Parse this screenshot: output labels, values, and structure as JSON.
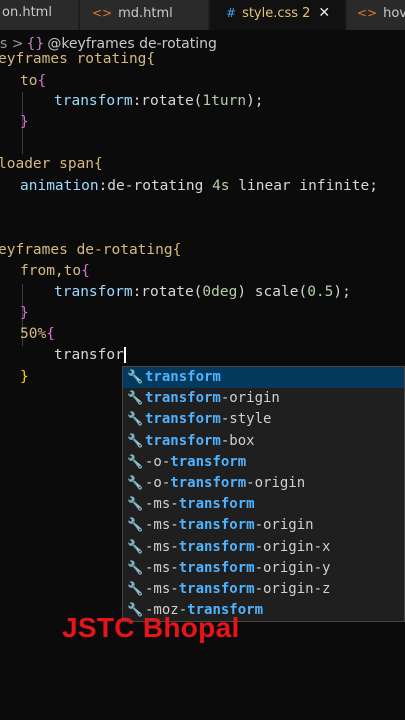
{
  "tabs": [
    {
      "label": "on.html",
      "icon": "",
      "active": false
    },
    {
      "label": "md.html",
      "icon": "<>",
      "active": false
    },
    {
      "label": "style.css",
      "icon": "#",
      "count": "2",
      "active": true
    },
    {
      "label": "hov",
      "icon": "<>",
      "active": false
    }
  ],
  "breadcrumb": {
    "prefix": "s >",
    "icon": "{}",
    "label": "@keyframes de-rotating"
  },
  "code": {
    "l0": "eyframes rotating{",
    "l1_a": "to",
    "l1_b": "{",
    "l2_a": "transform",
    "l2_b": ":rotate(",
    "l2_c": "1turn",
    "l2_d": ");",
    "l3": "}",
    "l5": "loader span{",
    "l6_a": "animation",
    "l6_b": ":de-rotating ",
    "l6_c": "4s",
    "l6_d": " linear infinite;",
    "l9": "eyframes de-rotating{",
    "l10_a": "from,to",
    "l10_b": "{",
    "l11_a": "transform",
    "l11_b": ":rotate(",
    "l11_c": "0deg",
    "l11_d": ") scale(",
    "l11_e": "0.5",
    "l11_f": ");",
    "l12": "}",
    "l13_a": "50%",
    "l13_b": "{",
    "l14": "transfor",
    "l15": "}"
  },
  "autocomplete": {
    "query": "transform",
    "items": [
      {
        "pre": "",
        "hl": "transform",
        "post": ""
      },
      {
        "pre": "",
        "hl": "transform",
        "post": "-origin"
      },
      {
        "pre": "",
        "hl": "transform",
        "post": "-style"
      },
      {
        "pre": "",
        "hl": "transform",
        "post": "-box"
      },
      {
        "pre": "-o-",
        "hl": "transform",
        "post": ""
      },
      {
        "pre": "-o-",
        "hl": "transform",
        "post": "-origin"
      },
      {
        "pre": "-ms-",
        "hl": "transform",
        "post": ""
      },
      {
        "pre": "-ms-",
        "hl": "transform",
        "post": "-origin"
      },
      {
        "pre": "-ms-",
        "hl": "transform",
        "post": "-origin-x"
      },
      {
        "pre": "-ms-",
        "hl": "transform",
        "post": "-origin-y"
      },
      {
        "pre": "-ms-",
        "hl": "transform",
        "post": "-origin-z"
      },
      {
        "pre": "-moz-",
        "hl": "transform",
        "post": ""
      }
    ]
  },
  "watermark": "JSTC Bhopal"
}
